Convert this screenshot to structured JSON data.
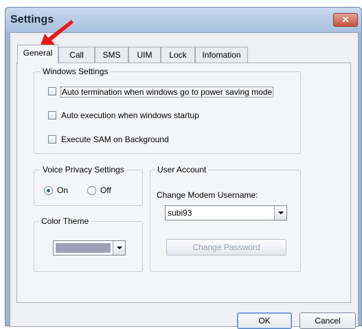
{
  "window": {
    "title": "Settings",
    "close_glyph": "✕"
  },
  "tabs": [
    {
      "label": "General",
      "active": true
    },
    {
      "label": "Call",
      "active": false
    },
    {
      "label": "SMS",
      "active": false
    },
    {
      "label": "UIM",
      "active": false
    },
    {
      "label": "Lock",
      "active": false
    },
    {
      "label": "Infomation",
      "active": false
    }
  ],
  "windows_settings": {
    "title": "Windows Settings",
    "options": [
      {
        "label": "Auto termination when windows go to power saving mode",
        "checked": false
      },
      {
        "label": "Auto execution when windows startup",
        "checked": false
      },
      {
        "label": "Execute SAM on Background",
        "checked": false
      }
    ]
  },
  "voice_privacy": {
    "title": "Voice Privacy Settings",
    "on_label": "On",
    "off_label": "Off",
    "selected": "On"
  },
  "color_theme": {
    "title": "Color Theme",
    "selected_color": "#a09fb9"
  },
  "user_account": {
    "title": "User Account",
    "username_label": "Change Modem Username:",
    "username_value": "subi93",
    "change_password_label": "Change Password"
  },
  "buttons": {
    "ok": "OK",
    "cancel": "Cancel"
  },
  "annotation": {
    "arrow_color": "#e8191c"
  }
}
